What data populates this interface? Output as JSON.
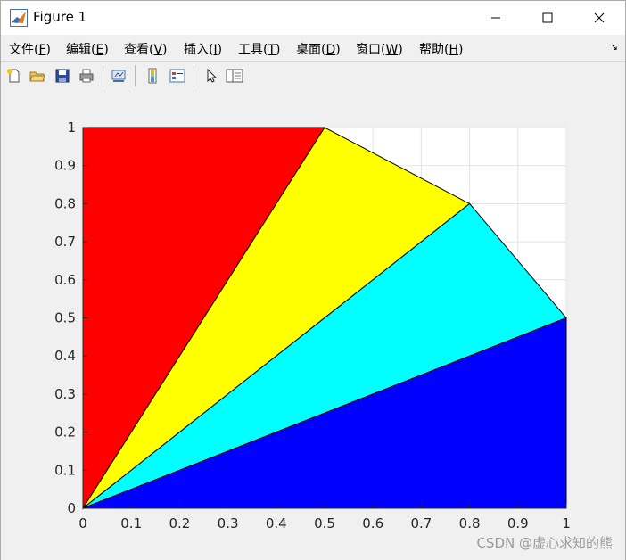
{
  "window": {
    "title": "Figure 1",
    "controls": {
      "minimize": "minimize",
      "maximize": "maximize",
      "close": "close"
    }
  },
  "menu": [
    {
      "label": "文件(",
      "key": "F",
      "tail": ")"
    },
    {
      "label": "编辑(",
      "key": "E",
      "tail": ")"
    },
    {
      "label": "查看(",
      "key": "V",
      "tail": ")"
    },
    {
      "label": "插入(",
      "key": "I",
      "tail": ")"
    },
    {
      "label": "工具(",
      "key": "T",
      "tail": ")"
    },
    {
      "label": "桌面(",
      "key": "D",
      "tail": ")"
    },
    {
      "label": "窗口(",
      "key": "W",
      "tail": ")"
    },
    {
      "label": "帮助(",
      "key": "H",
      "tail": ")"
    }
  ],
  "toolbar": {
    "buttons": [
      "new-figure-icon",
      "open-file-icon",
      "save-icon",
      "print-icon",
      "link-plot-icon",
      "colorbar-icon",
      "legend-icon",
      "pointer-icon",
      "property-inspector-icon"
    ]
  },
  "chart_data": {
    "type": "area",
    "title": "",
    "xlabel": "",
    "ylabel": "",
    "xlim": [
      0,
      1
    ],
    "ylim": [
      0,
      1
    ],
    "xticks": [
      "0",
      "0.1",
      "0.2",
      "0.3",
      "0.4",
      "0.5",
      "0.6",
      "0.7",
      "0.8",
      "0.9",
      "1"
    ],
    "yticks": [
      "0",
      "0.1",
      "0.2",
      "0.3",
      "0.4",
      "0.5",
      "0.6",
      "0.7",
      "0.8",
      "0.9",
      "1"
    ],
    "grid": true,
    "polygons": [
      {
        "color": "#ff0000",
        "points": [
          [
            0,
            0
          ],
          [
            0,
            1
          ],
          [
            0.5,
            1
          ]
        ]
      },
      {
        "color": "#ffff00",
        "points": [
          [
            0,
            0
          ],
          [
            0.5,
            1
          ],
          [
            0.8,
            0.8
          ]
        ]
      },
      {
        "color": "#00ffff",
        "points": [
          [
            0,
            0
          ],
          [
            0.8,
            0.8
          ],
          [
            1,
            0.5
          ]
        ]
      },
      {
        "color": "#0000ff",
        "points": [
          [
            0,
            0
          ],
          [
            1,
            0.5
          ],
          [
            1,
            0
          ]
        ]
      }
    ]
  },
  "watermark": "CSDN @虚心求知的熊"
}
